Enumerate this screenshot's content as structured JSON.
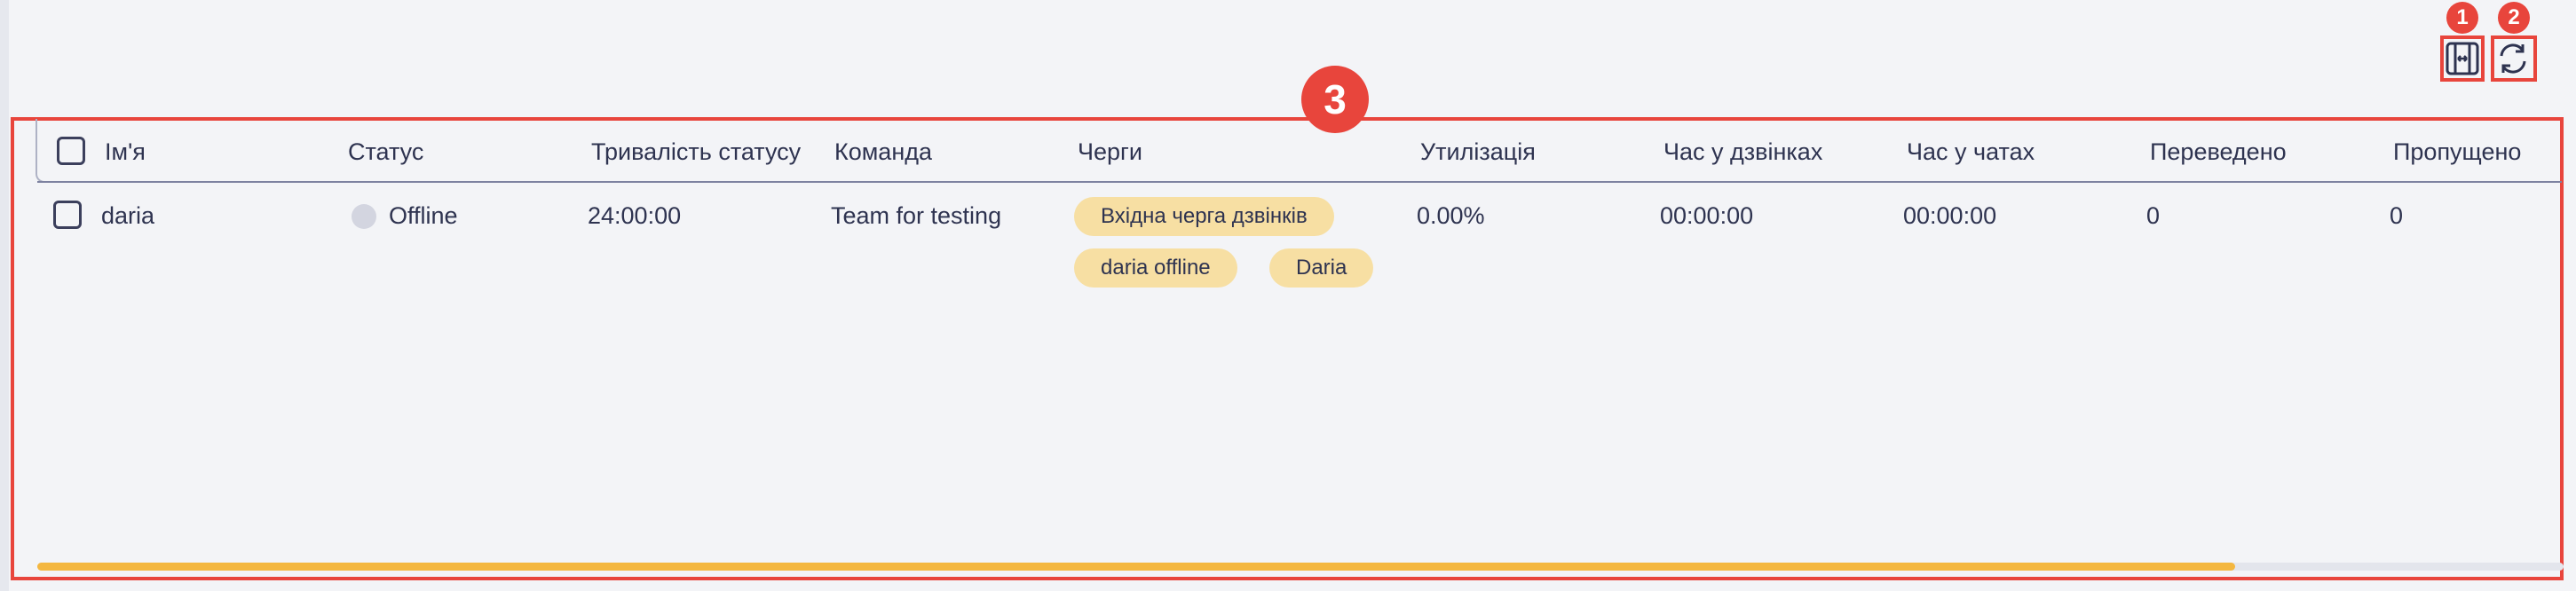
{
  "toolbar": {
    "fit_columns_icon": "fit-columns-icon",
    "refresh_icon": "refresh-icon"
  },
  "annotations": {
    "badge_1": "1",
    "badge_2": "2",
    "badge_3": "3"
  },
  "table": {
    "columns": [
      "Ім'я",
      "Статус",
      "Тривалість статусу",
      "Команда",
      "Черги",
      "Утилізація",
      "Час у дзвінках",
      "Час у чатах",
      "Переведено",
      "Пропущено"
    ],
    "rows": [
      {
        "name": "daria",
        "status": "Offline",
        "status_duration": "24:00:00",
        "team": "Team for testing",
        "queues": [
          "Вхідна черга дзвінків",
          "daria offline",
          "Daria"
        ],
        "utilization": "0.00%",
        "call_time": "00:00:00",
        "chat_time": "00:00:00",
        "transferred": "0",
        "missed": "0"
      }
    ]
  },
  "scrollbar": {
    "position_fraction": 0.87
  },
  "colors": {
    "accent": "#f4b740",
    "annotation": "#e8453c",
    "tag_bg": "#f7dfa3",
    "status_offline": "#d3d5e0"
  }
}
